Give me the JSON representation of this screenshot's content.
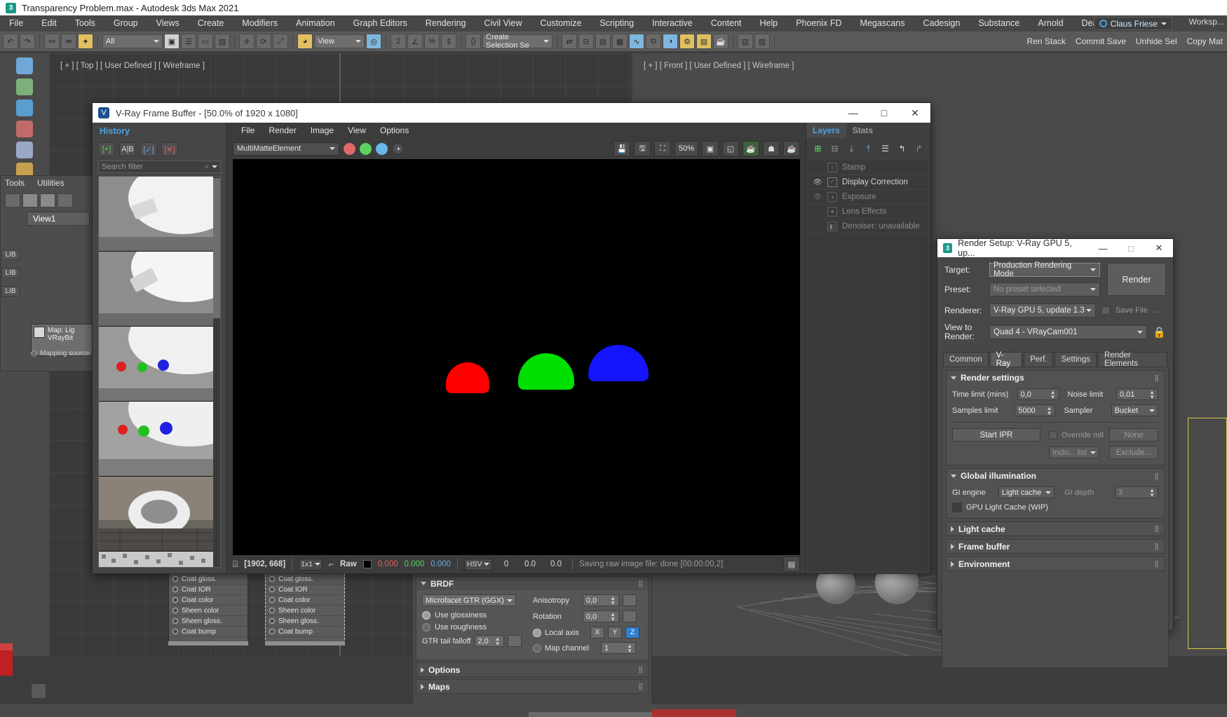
{
  "app": {
    "title": "Transparency Problem.max - Autodesk 3ds Max 2021",
    "logo_text": "3",
    "menu": [
      "File",
      "Edit",
      "Tools",
      "Group",
      "Views",
      "Create",
      "Modifiers",
      "Animation",
      "Graph Editors",
      "Rendering",
      "Civil View",
      "Customize",
      "Scripting",
      "Interactive",
      "Content",
      "Help",
      "Phoenix FD",
      "Megascans",
      "Cadesign",
      "Substance",
      "Arnold",
      "Deadline"
    ],
    "user": "Claus Friese",
    "workspace": "Worksp...",
    "toolbar": {
      "selection_filter": "All",
      "view_coord": "View",
      "selection_set": "Create Selection Se",
      "right_items": [
        "Ren Stack",
        "Commit Save",
        "Unhide Sel",
        "Copy Mat"
      ]
    },
    "viewport_labels": {
      "top": "[ + ] [ Top ] [ User Defined ] [ Wireframe ]",
      "front": "[ + ] [ Front ] [ User Defined ] [ Wireframe ]"
    },
    "util_panel": {
      "tabs": [
        "Tools",
        "Utilities"
      ],
      "view_tab": "View1",
      "lib_tags": [
        "LIB",
        "LIB",
        "LIB"
      ],
      "map_node_title": "Map:  Lig",
      "map_node_sub": "VRayBit",
      "map_source": "Mapping source"
    }
  },
  "vfb": {
    "title": "V-Ray Frame Buffer - [50.0% of 1920 x 1080]",
    "logo": "V",
    "win_buttons": [
      "—",
      "□",
      "✕"
    ],
    "history": {
      "header": "History",
      "buttons": [
        "[+]",
        "A|B",
        "[✓]",
        "[✕]"
      ],
      "search_placeholder": "Search filter",
      "search_value": ""
    },
    "menu": [
      "File",
      "Render",
      "Image",
      "View",
      "Options"
    ],
    "channel": "MultiMatteElement",
    "zoom_level": "50%",
    "status": {
      "coords": "[1902, 668]",
      "pixel_format": "1x1",
      "mode": "Raw",
      "r": "0.000",
      "g": "0.000",
      "b": "0.000",
      "color_space": "HSV",
      "h": "0",
      "s": "0.0",
      "v": "0.0",
      "message": "Saving raw image file: done [00:00:00,2]"
    },
    "layers": {
      "tabs": [
        "Layers",
        "Stats"
      ],
      "active_tab": "Layers",
      "rows": [
        {
          "label": "Stamp",
          "visible": false,
          "enabled": false,
          "icon": "i"
        },
        {
          "label": "Display Correction",
          "visible": true,
          "enabled": true,
          "icon": "curve"
        },
        {
          "label": "Exposure",
          "visible": true,
          "enabled": false,
          "icon": "contrast"
        },
        {
          "label": "Lens Effects",
          "visible": false,
          "enabled": false,
          "icon": "star"
        },
        {
          "label": "Denoiser: unavailable",
          "visible": false,
          "enabled": false,
          "icon": "split"
        }
      ]
    },
    "render_spheres": [
      {
        "name": "red-dome",
        "color": "#ff0000"
      },
      {
        "name": "green-dome",
        "color": "#00e000"
      },
      {
        "name": "blue-dome",
        "color": "#1414ff"
      }
    ]
  },
  "render_setup": {
    "title": "Render Setup: V-Ray GPU 5, up...",
    "logo_text": "3",
    "win_buttons": [
      "—",
      "□",
      "✕"
    ],
    "target_label": "Target:",
    "target_value": "Production Rendering Mode",
    "preset_label": "Preset:",
    "preset_value": "No preset selected",
    "renderer_label": "Renderer:",
    "renderer_value": "V-Ray GPU 5, update 1.3",
    "render_button": "Render",
    "save_file_label": "Save File",
    "save_file_ellipsis": "...",
    "view_to_render_label": "View to Render:",
    "view_to_render_value": "Quad 4 - VRayCam001",
    "lock_icon": "lock",
    "tabs": [
      "Common",
      "V-Ray",
      "Perf.",
      "Settings",
      "Render Elements"
    ],
    "active_tab": "V-Ray",
    "render_settings": {
      "title": "Render settings",
      "time_limit_label": "Time limit (mins)",
      "time_limit_value": "0,0",
      "noise_limit_label": "Noise limit",
      "noise_limit_value": "0,01",
      "samples_limit_label": "Samples limit",
      "samples_limit_value": "5000",
      "sampler_label": "Sampler",
      "sampler_value": "Bucket",
      "start_ipr": "Start IPR",
      "override_mtl_label": "Override mtl",
      "override_mtl_none": "None",
      "include_list": "Inclu... list",
      "exclude_button": "Exclude..."
    },
    "global_illumination": {
      "title": "Global illumination",
      "gi_engine_label": "GI engine",
      "gi_engine_value": "Light cache",
      "gi_depth_label": "GI depth",
      "gi_depth_value": "3",
      "gpu_light_cache_label": "GPU Light Cache (WIP)"
    },
    "collapsed_rollouts": [
      "Light cache",
      "Frame buffer",
      "Environment"
    ]
  },
  "material_props": {
    "brdf": {
      "title": "BRDF",
      "model": "Microfacet GTR (GGX)",
      "use_glossiness": "Use glossiness",
      "use_roughness": "Use roughness",
      "gtr_tail_label": "GTR tail falloff",
      "gtr_tail_value": "2,0",
      "anisotropy_label": "Anisotropy",
      "anisotropy_value": "0,0",
      "rotation_label": "Rotation",
      "rotation_value": "0,0",
      "local_axis_label": "Local axis",
      "axes": [
        "X",
        "Y",
        "Z"
      ],
      "active_axis": "Z",
      "map_channel_label": "Map channel",
      "map_channel_value": "1"
    },
    "options_title": "Options",
    "maps_title": "Maps",
    "node_rows_left": [
      "Coat gloss.",
      "Coat IOR",
      "Coat color",
      "Sheen color",
      "Sheen gloss.",
      "Coat bump"
    ],
    "node_rows_right": [
      "Coat gloss.",
      "Coat IOR",
      "Coat color",
      "Sheen color",
      "Sheen gloss.",
      "Coat bump"
    ]
  },
  "colors": {
    "accent_blue": "#4aa3df",
    "title_white": "#ffffff",
    "panel_gray": "#4a4a4a",
    "canvas_black": "#000000",
    "axis_active": "#2f7fd0"
  }
}
